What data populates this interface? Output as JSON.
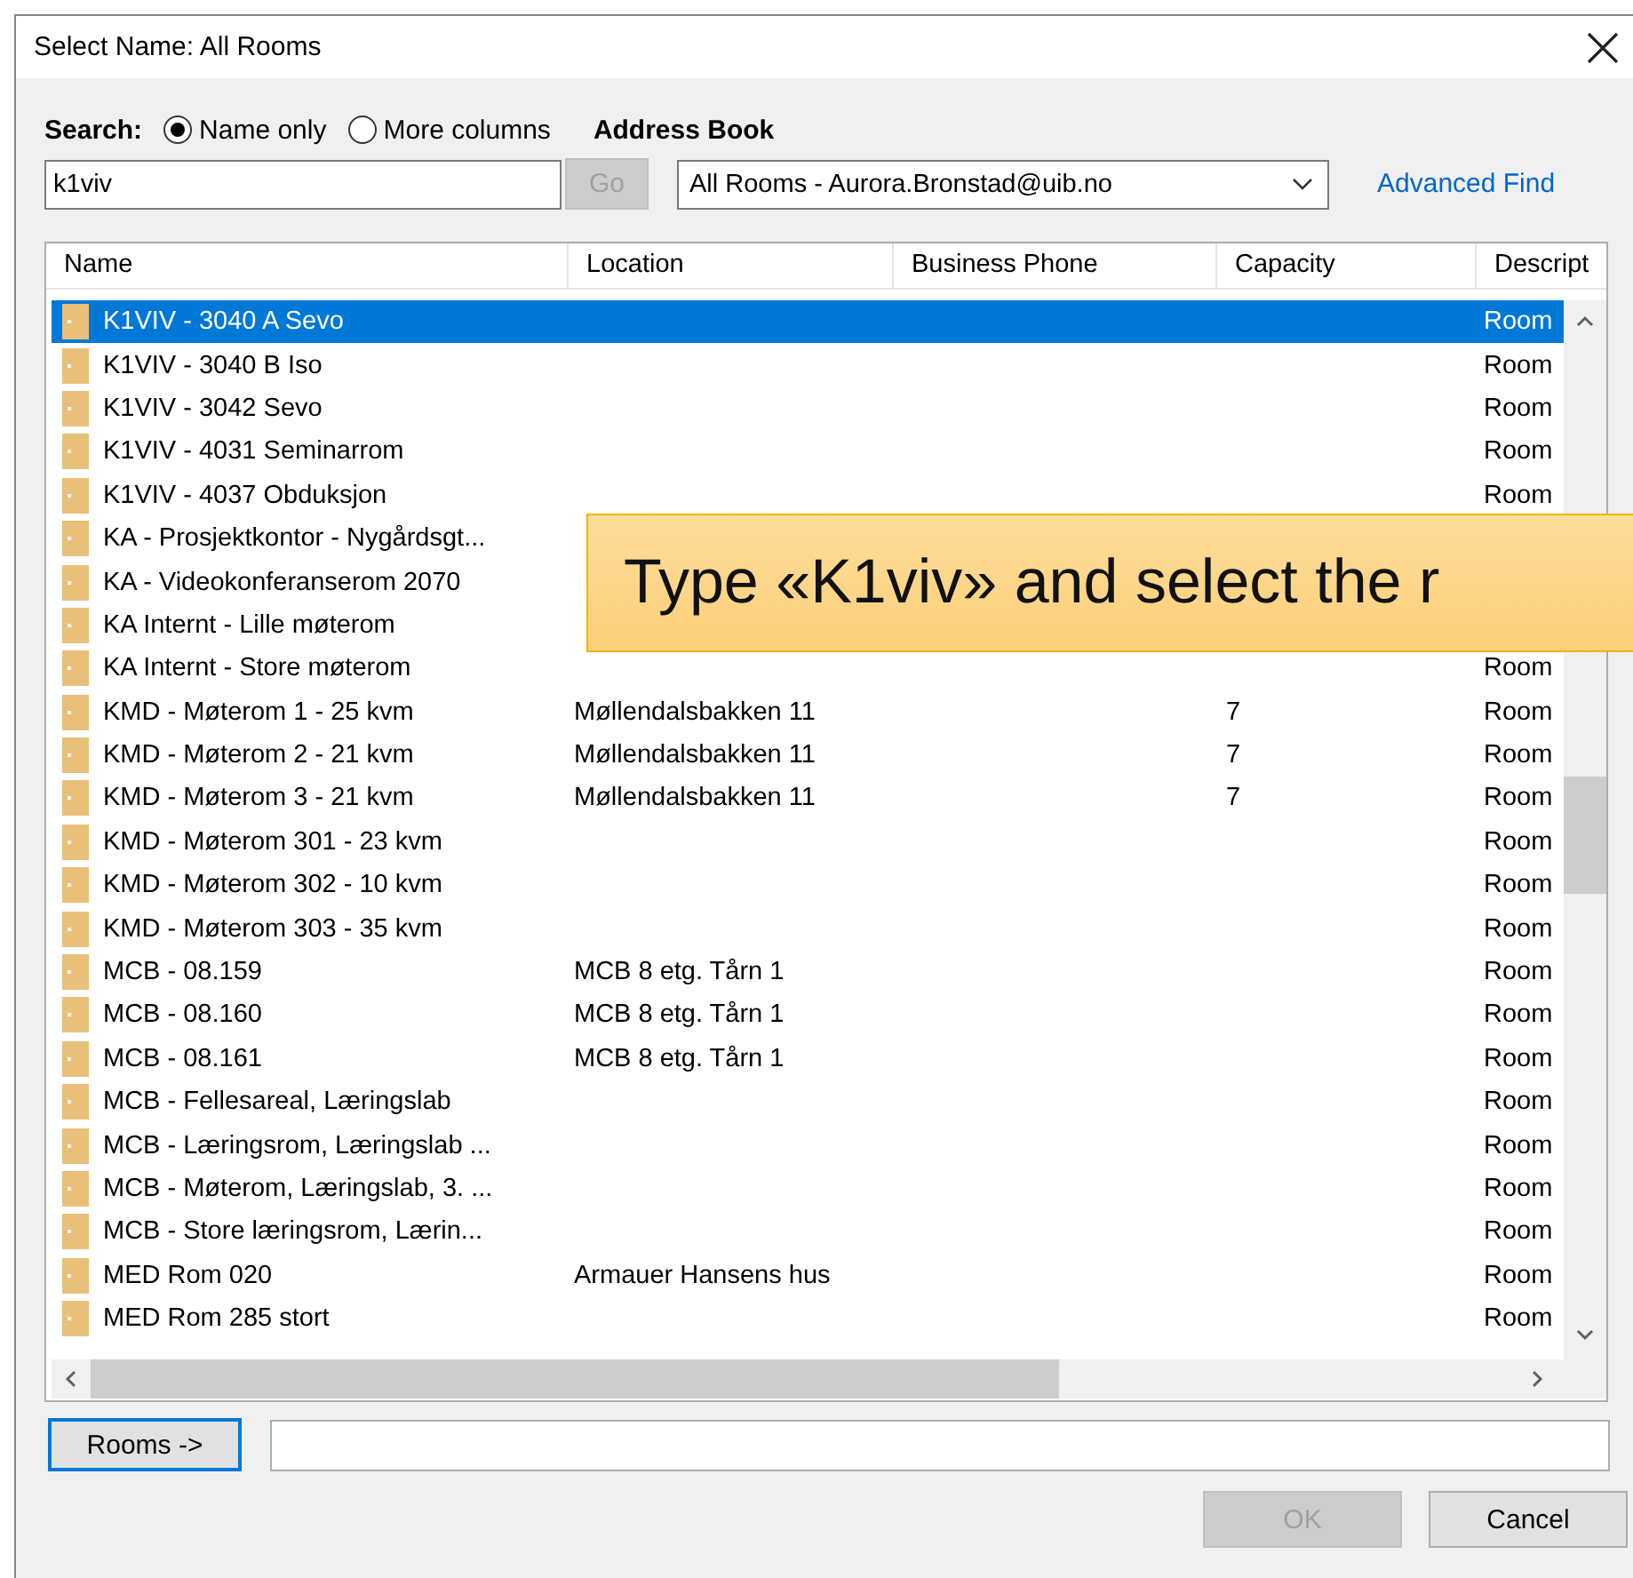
{
  "window": {
    "title": "Select Name: All Rooms"
  },
  "search": {
    "label": "Search:",
    "options": [
      {
        "label": "Name only",
        "selected": true
      },
      {
        "label": "More columns",
        "selected": false
      }
    ],
    "value": "k1viv",
    "go_button": {
      "label": "Go",
      "disabled": true
    }
  },
  "address_book": {
    "label": "Address Book",
    "value": "All Rooms - Aurora.Bronstad@uib.no",
    "advanced_find": {
      "label": "Advanced Find"
    }
  },
  "table": {
    "columns": [
      "Name",
      "Location",
      "Business Phone",
      "Capacity",
      "Descript"
    ],
    "rows": [
      {
        "name": "K1VIV - 3040 A Sevo",
        "description": "Room",
        "selected": true
      },
      {
        "name": "K1VIV - 3040 B Iso",
        "description": "Room",
        "selected": false
      },
      {
        "name": "K1VIV - 3042 Sevo",
        "description": "Room",
        "selected": false
      },
      {
        "name": "K1VIV - 4031 Seminarrom",
        "description": "Room",
        "selected": false
      },
      {
        "name": "K1VIV - 4037 Obduksjon",
        "description": "Room",
        "selected": false
      },
      {
        "name": "KA - Prosjektkontor - Nygårdsgt...",
        "selected": false
      },
      {
        "name": "KA - Videokonferanserom 2070",
        "selected": false
      },
      {
        "name": "KA Internt - Lille møterom",
        "selected": false
      },
      {
        "name": "KA Internt - Store møterom",
        "description": "Room",
        "selected": false
      },
      {
        "name": "KMD - Møterom 1 - 25 kvm",
        "location": "Møllendalsbakken 11",
        "capacity": "7",
        "description": "Room",
        "selected": false
      },
      {
        "name": "KMD - Møterom 2 - 21 kvm",
        "location": "Møllendalsbakken 11",
        "capacity": "7",
        "description": "Room",
        "selected": false
      },
      {
        "name": "KMD - Møterom 3 - 21 kvm",
        "location": "Møllendalsbakken 11",
        "capacity": "7",
        "description": "Room",
        "selected": false
      },
      {
        "name": "KMD - Møterom 301 - 23 kvm",
        "description": "Room",
        "selected": false
      },
      {
        "name": "KMD - Møterom 302 - 10 kvm",
        "description": "Room",
        "selected": false
      },
      {
        "name": "KMD - Møterom 303 - 35 kvm",
        "description": "Room",
        "selected": false
      },
      {
        "name": "MCB - 08.159",
        "location": "MCB 8 etg. Tårn 1",
        "description": "Room",
        "selected": false
      },
      {
        "name": "MCB - 08.160",
        "location": "MCB 8 etg. Tårn 1",
        "description": "Room",
        "selected": false
      },
      {
        "name": "MCB - 08.161",
        "location": "MCB 8 etg. Tårn 1",
        "description": "Room",
        "selected": false
      },
      {
        "name": "MCB - Fellesareal, Læringslab",
        "description": "Room",
        "selected": false
      },
      {
        "name": "MCB - Læringsrom, Læringslab ...",
        "description": "Room",
        "selected": false
      },
      {
        "name": "MCB - Møterom, Læringslab, 3. ...",
        "description": "Room",
        "selected": false
      },
      {
        "name": "MCB - Store læringsrom, Lærin...",
        "description": "Room",
        "selected": false
      },
      {
        "name": "MED Rom 020",
        "location": "Armauer Hansens hus",
        "description": "Room",
        "selected": false
      },
      {
        "name": "MED Rom 285 stort",
        "description": "Room",
        "selected": false
      }
    ]
  },
  "rooms_button": {
    "label": "Rooms ->"
  },
  "buttons": [
    {
      "label": "OK",
      "disabled": true
    },
    {
      "label": "Cancel",
      "disabled": false
    }
  ],
  "callout": {
    "text": "Type «K1viv» and select the r"
  }
}
